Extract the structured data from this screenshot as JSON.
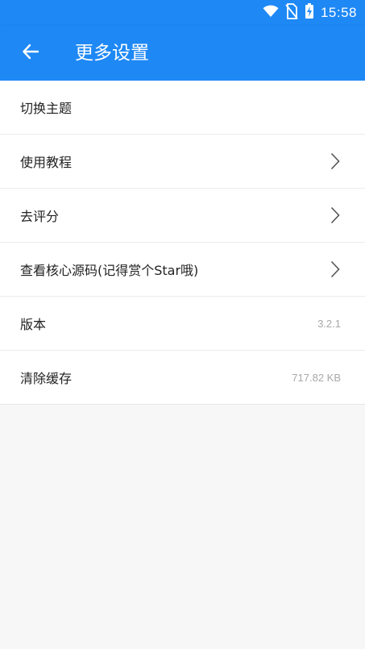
{
  "status_bar": {
    "time": "15:58",
    "icons": [
      "wifi-icon",
      "no-sim-icon",
      "battery-charging-icon"
    ]
  },
  "app_bar": {
    "back_icon": "arrow-left-icon",
    "title": "更多设置"
  },
  "settings": {
    "items": [
      {
        "label": "切换主题"
      },
      {
        "label": "使用教程",
        "icon": "chevron-right-icon"
      },
      {
        "label": "去评分",
        "icon": "chevron-right-icon"
      },
      {
        "label": "查看核心源码(记得赏个Star哦)",
        "icon": "chevron-right-icon"
      },
      {
        "label": "版本",
        "value": "3.2.1"
      },
      {
        "label": "清除缓存",
        "value": "717.82 KB"
      }
    ]
  },
  "colors": {
    "primary": "#1e88f5",
    "background": "#f7f7f7",
    "text": "#222222",
    "secondary_text": "#a8a8a8"
  }
}
